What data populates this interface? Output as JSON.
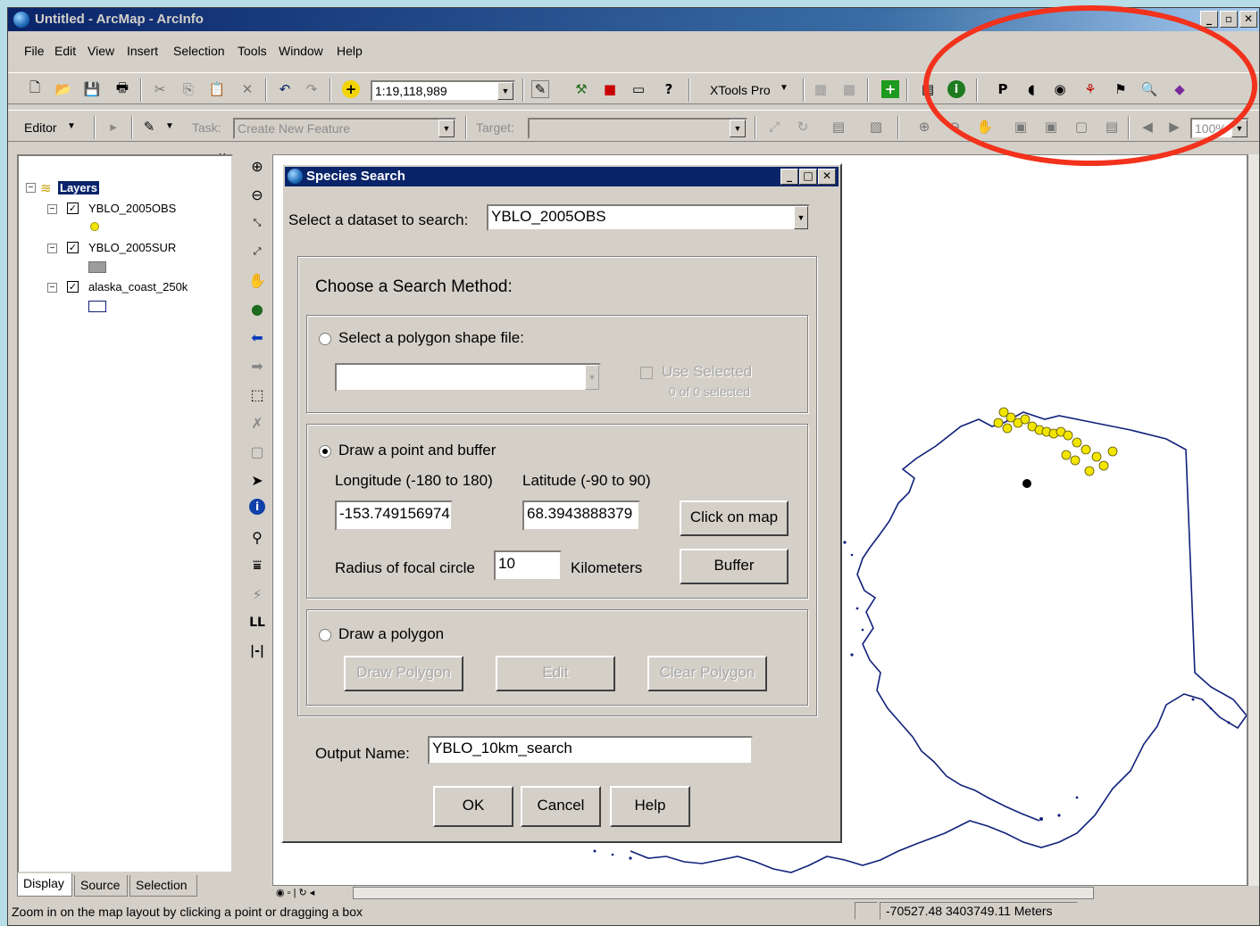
{
  "window": {
    "title": "Untitled - ArcMap - ArcInfo"
  },
  "menu": [
    "File",
    "Edit",
    "View",
    "Insert",
    "Selection",
    "Tools",
    "Window",
    "Help"
  ],
  "toolbar": {
    "scale": "1:19,118,989",
    "xtools": "XTools Pro",
    "editor": "Editor",
    "task_label": "Task:",
    "task_value": "Create New Feature",
    "target_label": "Target:",
    "zoom_value": "100%"
  },
  "toc": {
    "root": "Layers",
    "layers": [
      {
        "name": "YBLO_2005OBS",
        "checked": true
      },
      {
        "name": "YBLO_2005SUR",
        "checked": true
      },
      {
        "name": "alaska_coast_250k",
        "checked": true
      }
    ],
    "tabs": [
      "Display",
      "Source",
      "Selection"
    ]
  },
  "dialog": {
    "title": "Species Search",
    "dataset_label": "Select a dataset to search:",
    "dataset_value": "YBLO_2005OBS",
    "method_heading": "Choose a Search Method:",
    "polygon_file_label": "Select a polygon shape file:",
    "use_selected_label": "Use Selected",
    "selected_count": "0 of 0 selected",
    "point_buffer_label": "Draw a point and buffer",
    "longitude_label": "Longitude (-180 to 180)",
    "latitude_label": "Latitude (-90 to 90)",
    "longitude_value": "-153.749156974",
    "latitude_value": "68.3943888379",
    "click_on_map": "Click on map",
    "radius_label": "Radius of focal circle",
    "radius_value": "10",
    "km_label": "Kilometers",
    "buffer": "Buffer",
    "draw_polygon_label": "Draw a polygon",
    "draw_polygon_btn": "Draw Polygon",
    "edit_btn": "Edit",
    "clear_polygon_btn": "Clear Polygon",
    "output_label": "Output Name:",
    "output_value": "YBLO_10km_search",
    "ok": "OK",
    "cancel": "Cancel",
    "help": "Help"
  },
  "status": {
    "message": "Zoom in on the map layout by clicking a point or dragging a box",
    "coords": "-70527.48  3403749.11 Meters"
  },
  "colors": {
    "annotation": "#f2321c",
    "titlebar": "#0a246a",
    "points": "#f2e600",
    "coast": "#10207a"
  }
}
